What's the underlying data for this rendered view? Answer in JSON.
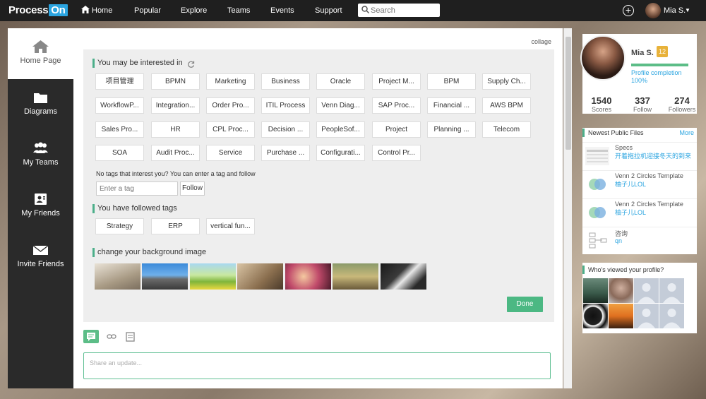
{
  "brand": {
    "name": "Process",
    "suffix": "On"
  },
  "nav": {
    "home": "Home",
    "popular": "Popular",
    "explore": "Explore",
    "teams": "Teams",
    "events": "Events",
    "support": "Support"
  },
  "search": {
    "placeholder": "Search"
  },
  "user": {
    "name": "Mia S."
  },
  "sidebar": {
    "items": [
      {
        "label": "Home Page"
      },
      {
        "label": "Diagrams"
      },
      {
        "label": "My Teams"
      },
      {
        "label": "My Friends"
      },
      {
        "label": "Invite Friends"
      }
    ]
  },
  "main": {
    "collage_label": "collage",
    "interest": {
      "title": "You may be interested in",
      "tags": [
        "项目管理",
        "BPMN",
        "Marketing",
        "Business",
        "Oracle",
        "Project M...",
        "BPM",
        "Supply Ch...",
        "WorkflowP...",
        "Integration...",
        "Order Pro...",
        "ITIL Process",
        "Venn Diag...",
        "SAP Proc...",
        "Financial ...",
        "AWS BPM",
        "Sales Pro...",
        "HR",
        "CPL Proc...",
        "Decision ...",
        "PeopleSof...",
        "Project",
        "Planning ...",
        "Telecom",
        "SOA",
        "Audit Proc...",
        "Service",
        "Purchase ...",
        "Configurati...",
        "Control Pr..."
      ],
      "hint": "No tags that interest you? You can enter a tag and follow",
      "input_placeholder": "Enter a tag",
      "follow_label": "Follow"
    },
    "followed": {
      "title": "You have followed tags",
      "tags": [
        "Strategy",
        "ERP",
        "vertical fun..."
      ]
    },
    "background": {
      "title": "change your background image"
    },
    "done_label": "Done",
    "share_placeholder": "Share an update..."
  },
  "profile": {
    "name": "Mia S.",
    "badge": "12",
    "completion_label": "Profile completion",
    "completion_value": "100%",
    "completion_fraction": 1.0,
    "stats": [
      {
        "value": "1540",
        "label": "Scores"
      },
      {
        "value": "337",
        "label": "Follow"
      },
      {
        "value": "274",
        "label": "Followers"
      }
    ]
  },
  "files": {
    "title": "Newest Public Files",
    "more": "More",
    "items": [
      {
        "name": "Specs",
        "owner": "开着拖拉机迎接冬天的到来"
      },
      {
        "name": "Venn 2 Circles Template",
        "owner": "柚子儿LOL"
      },
      {
        "name": "Venn 2 Circles Template",
        "owner": "柚子儿LOL"
      },
      {
        "name": "咨询",
        "owner": "qn"
      }
    ]
  },
  "viewers": {
    "title": "Who's viewed your profile?"
  }
}
